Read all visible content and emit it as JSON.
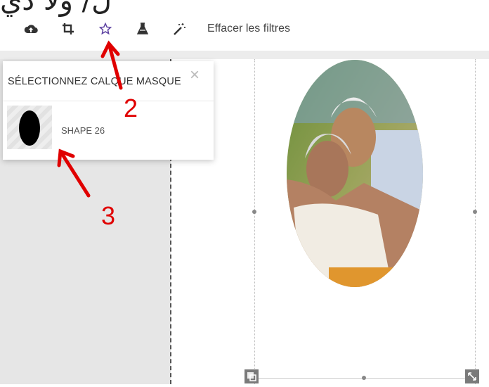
{
  "header": {
    "title_partial": "ل/ ولا دي"
  },
  "toolbar": {
    "icons": [
      "upload-cloud-icon",
      "crop-icon",
      "star-icon",
      "flask-icon",
      "magic-wand-icon"
    ],
    "clear_filters_label": "Effacer les filtres"
  },
  "mask_panel": {
    "title": "SÉLECTIONNEZ CALQUE MASQUE",
    "close_symbol": "×",
    "items": [
      {
        "label": "SHAPE 26",
        "shape": "oval"
      }
    ]
  },
  "annotations": {
    "arrow_2": "2",
    "arrow_3": "3",
    "color": "#e00000"
  },
  "colors": {
    "accent_star": "#5b3fa0",
    "panel_bg": "#ffffff",
    "workspace_bg": "#e6e6e6"
  }
}
